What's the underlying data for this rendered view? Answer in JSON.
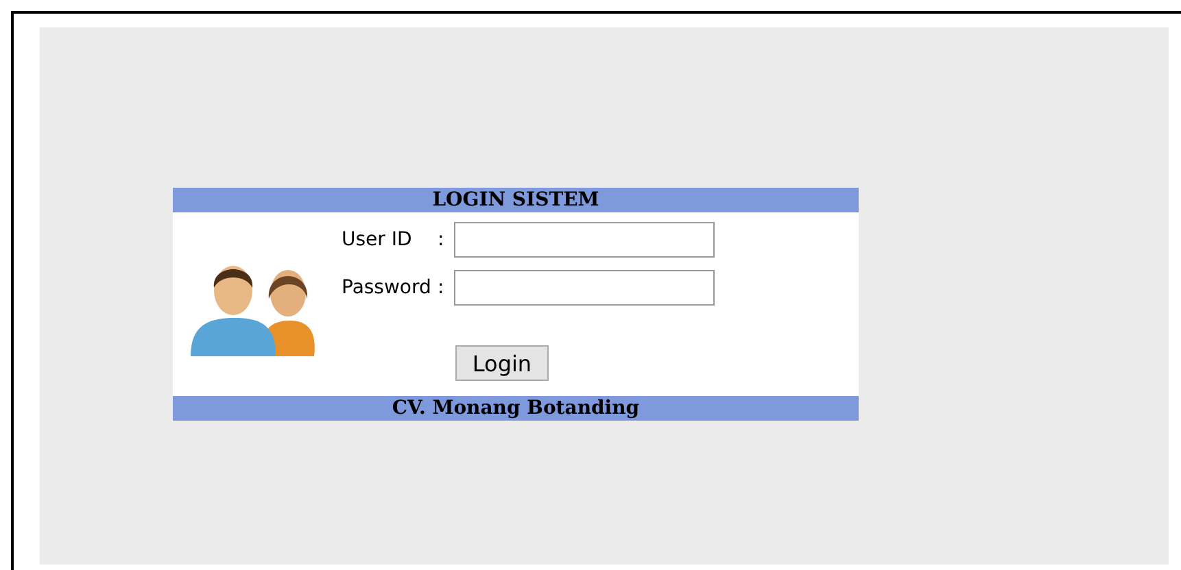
{
  "login": {
    "title": "LOGIN SISTEM",
    "fields": [
      {
        "label": "User ID",
        "separator": ":"
      },
      {
        "label": "Password",
        "separator": ":"
      }
    ],
    "button": "Login",
    "footer": "CV. Monang Botanding"
  }
}
